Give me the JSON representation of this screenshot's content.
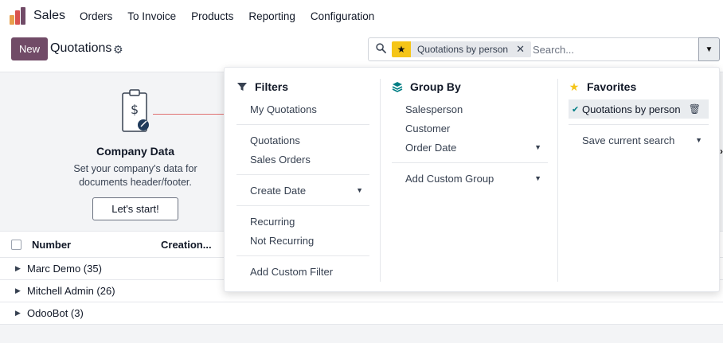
{
  "topbar": {
    "app_name": "Sales",
    "menu": [
      "Orders",
      "To Invoice",
      "Products",
      "Reporting",
      "Configuration"
    ]
  },
  "control": {
    "new_label": "New",
    "title": "Quotations"
  },
  "search": {
    "facet_label": "Quotations by person",
    "placeholder": "Search..."
  },
  "helper": {
    "title": "Company Data",
    "text_line1": "Set your company's data for",
    "text_line2": "documents header/footer.",
    "button": "Let's start!"
  },
  "list": {
    "col_number": "Number",
    "col_creation": "Creation...",
    "groups": [
      "Marc Demo (35)",
      "Mitchell Admin (26)",
      "OdooBot (3)"
    ]
  },
  "filters": {
    "title": "Filters",
    "my_quotations": "My Quotations",
    "quotations": "Quotations",
    "sales_orders": "Sales Orders",
    "create_date": "Create Date",
    "recurring": "Recurring",
    "not_recurring": "Not Recurring",
    "add_custom": "Add Custom Filter"
  },
  "groupby": {
    "title": "Group By",
    "salesperson": "Salesperson",
    "customer": "Customer",
    "order_date": "Order Date",
    "add_custom": "Add Custom Group"
  },
  "favorites": {
    "title": "Favorites",
    "active": "Quotations by person",
    "save": "Save current search"
  },
  "colors": {
    "primary": "#714b67",
    "star": "#f5c518",
    "teal": "#017e84"
  }
}
